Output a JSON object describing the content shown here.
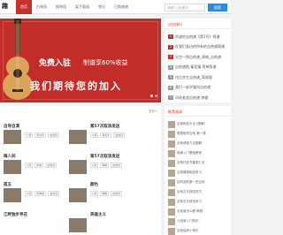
{
  "header": {
    "logo": "趣",
    "nav": [
      {
        "label": "首页",
        "active": true
      },
      {
        "label": "古琴园",
        "active": false
      },
      {
        "label": "钢琴园",
        "active": false
      },
      {
        "label": "架子鼓园",
        "active": false
      },
      {
        "label": "弦乐",
        "active": false
      },
      {
        "label": "已购曲谱",
        "active": false
      }
    ],
    "search_placeholder": "请输入关键词",
    "search_button": "搜索"
  },
  "banner": {
    "line1": "免费入驻",
    "line1_sub": "制谱享60%收益",
    "line2": "我们期待您的加入"
  },
  "hot": {
    "title": "点击排行",
    "items": [
      "尚波的吉他谱《第1号》简谱",
      "在我们身边的所有的吉他谱简谱",
      "天空一鸽吉他谱_演唱_吉他谱",
      "吉他谱图 童话镇 简单版谱",
      "往后余生吉他谱_简易版",
      "我们一起学猫叫吉他谱",
      "风吹麦浪吉他谱 李健",
      "红山果吉他谱 安与骑兵",
      "成都吉他谱 赵雷 原版"
    ]
  },
  "main": {
    "more": "更多>",
    "cards": [
      {
        "title": "自导自演",
        "tags": [
          "C调",
          "周杰伦",
          "吉他谱"
        ]
      },
      {
        "title": "第57次取消发送",
        "tags": [
          "C调",
          "菲道尔",
          "吉他谱"
        ]
      },
      {
        "title": "嗨人间",
        "tags": [
          "C调",
          "简单",
          "吉他谱"
        ]
      },
      {
        "title": "第57次取消发送",
        "tags": [
          "C调",
          "弹唱",
          "吉他谱"
        ]
      },
      {
        "title": "孤玉",
        "tags": [
          "G调",
          "简单版",
          "吉他谱"
        ]
      },
      {
        "title": "颜色",
        "tags": [
          "C调",
          "弹唱",
          "吉他谱"
        ]
      },
      {
        "title": "江畔独步寻花",
        "tags": []
      },
      {
        "title": "英雄主义",
        "tags": []
      }
    ]
  },
  "recommend": {
    "title": "推荐阅读",
    "items": [
      "吉他和弦大全 (图解)",
      "零基础学吉他 第一课",
      "吉他调音方法图解",
      "指弹入门基础教程",
      "吉他扫弦节奏型汇总",
      "吉他横按和弦练习",
      "如何选购第一把吉他",
      "吉他左手按弦技巧",
      "吉他右手拨弦练习",
      "吉他谱怎么看 教程",
      "六线谱入门知识",
      "吉他保养小常识"
    ]
  }
}
